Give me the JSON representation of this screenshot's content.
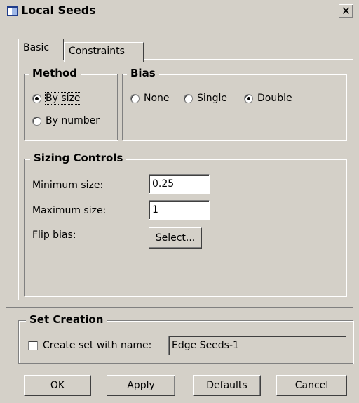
{
  "window": {
    "title": "Local Seeds",
    "close_glyph": "✕"
  },
  "tabs": [
    {
      "label": "Basic",
      "active": true
    },
    {
      "label": "Constraints",
      "active": false
    }
  ],
  "method": {
    "title": "Method",
    "options": [
      {
        "label": "By size",
        "selected": true
      },
      {
        "label": "By number",
        "selected": false
      }
    ]
  },
  "bias": {
    "title": "Bias",
    "options": [
      {
        "label": "None",
        "selected": false
      },
      {
        "label": "Single",
        "selected": false
      },
      {
        "label": "Double",
        "selected": true
      }
    ]
  },
  "sizing": {
    "title": "Sizing Controls",
    "min_label": "Minimum size:",
    "min_value": "0.25",
    "max_label": "Maximum size:",
    "max_value": "1",
    "flip_label": "Flip bias:",
    "select_button": "Select..."
  },
  "set_creation": {
    "title": "Set Creation",
    "checkbox_label": "Create set with name:",
    "checked": false,
    "name_value": "Edge Seeds-1"
  },
  "buttons": {
    "ok": "OK",
    "apply": "Apply",
    "defaults": "Defaults",
    "cancel": "Cancel"
  }
}
